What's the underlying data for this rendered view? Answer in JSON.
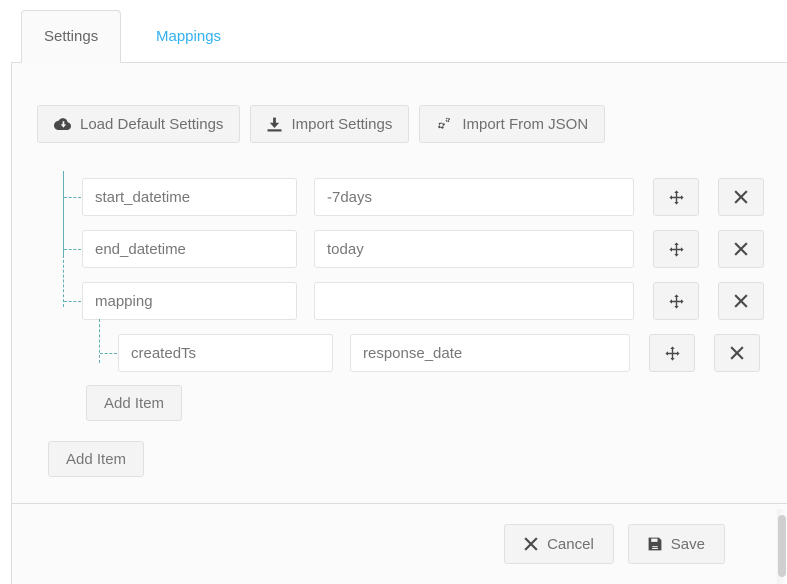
{
  "tabs": [
    {
      "id": "settings",
      "label": "Settings",
      "active": true
    },
    {
      "id": "mappings",
      "label": "Mappings",
      "active": false
    }
  ],
  "toolbar": {
    "load_default_label": "Load Default Settings",
    "load_default_icon": "cloud-download-icon",
    "import_settings_label": "Import Settings",
    "import_settings_icon": "download-icon",
    "import_json_label": "Import From JSON",
    "import_json_icon": "cogs-icon"
  },
  "form": {
    "rows": [
      {
        "key": "start_datetime",
        "value": "-7days",
        "key_placeholder": "",
        "value_placeholder": "",
        "move_icon": "arrows-move-icon",
        "delete_icon": "times-icon",
        "level": 1
      },
      {
        "key": "end_datetime",
        "value": "today",
        "key_placeholder": "",
        "value_placeholder": "",
        "move_icon": "arrows-move-icon",
        "delete_icon": "times-icon",
        "level": 1
      },
      {
        "key": "mapping",
        "value": "",
        "key_placeholder": "",
        "value_placeholder": "",
        "move_icon": "arrows-move-icon",
        "delete_icon": "times-icon",
        "level": 1
      },
      {
        "key": "createdTs",
        "value": "response_date",
        "key_placeholder": "",
        "value_placeholder": "",
        "move_icon": "arrows-move-icon",
        "delete_icon": "times-icon",
        "level": 2
      }
    ],
    "add_item_nested_label": "Add Item",
    "add_item_root_label": "Add Item"
  },
  "footer": {
    "cancel_label": "Cancel",
    "cancel_icon": "times-icon",
    "save_label": "Save",
    "save_icon": "floppy-save-icon"
  },
  "colors": {
    "accent_tab": "#31b0f0",
    "tree_line": "#64aeb5",
    "panel_bg": "#fbfbfb",
    "button_bg": "#f4f4f4",
    "border": "#dddddd",
    "text": "#6f6f6f"
  }
}
